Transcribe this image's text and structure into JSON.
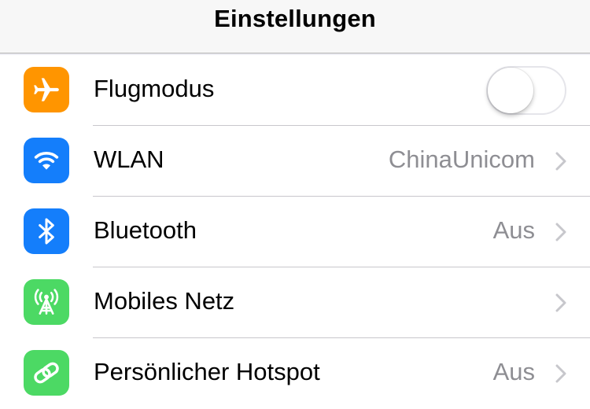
{
  "header": {
    "title": "Einstellungen"
  },
  "colors": {
    "orange": "#ff9500",
    "blue": "#147efb",
    "green": "#4cd964",
    "secondary_text": "#8e8e93"
  },
  "rows": [
    {
      "label": "Flugmodus",
      "icon": "airplane-icon",
      "toggle_on": false
    },
    {
      "label": "WLAN",
      "icon": "wifi-icon",
      "value": "ChinaUnicom"
    },
    {
      "label": "Bluetooth",
      "icon": "bluetooth-icon",
      "value": "Aus"
    },
    {
      "label": "Mobiles Netz",
      "icon": "cellular-antenna-icon",
      "value": ""
    },
    {
      "label": "Persönlicher Hotspot",
      "icon": "hotspot-icon",
      "value": "Aus"
    }
  ]
}
